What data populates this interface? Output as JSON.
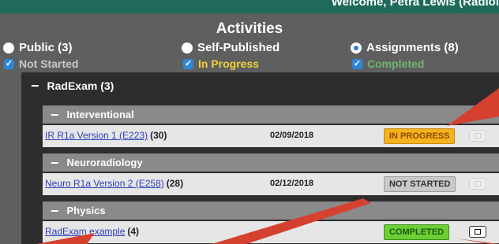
{
  "header": {
    "welcome_text": "Welcome, Petra Lewis (Radiol",
    "bar_color": "#1f6a5a"
  },
  "activities": {
    "title": "Activities",
    "filters": [
      {
        "label": "Public (3)",
        "checked": false
      },
      {
        "label": "Self-Published",
        "checked": false
      },
      {
        "label": "Assignments (8)",
        "checked": true
      }
    ],
    "status_filters": [
      {
        "label": "Not Started",
        "checked": true,
        "color": "#c9c9c9"
      },
      {
        "label": "In Progress",
        "checked": true,
        "color": "#f0d23a"
      },
      {
        "label": "Completed",
        "checked": true,
        "color": "#6bb56b"
      }
    ]
  },
  "radexam": {
    "group_label": "RadExam (3)",
    "sections": [
      {
        "title": "Interventional",
        "item": {
          "link": "IR R1a Version 1 (E223)",
          "count": "(30)",
          "date": "02/09/2018",
          "status": "IN PROGRESS",
          "status_key": "ip",
          "action_enabled": false
        }
      },
      {
        "title": "Neuroradiology",
        "item": {
          "link": "Neuro R1a Version 2 (E258)",
          "count": "(28)",
          "date": "02/12/2018",
          "status": "NOT STARTED",
          "status_key": "ns",
          "action_enabled": false
        }
      },
      {
        "title": "Physics",
        "item": {
          "link": "RadExam example",
          "count": "(4)",
          "date": "",
          "status": "COMPLETED",
          "status_key": "co",
          "action_enabled": true
        }
      }
    ]
  },
  "icons": {
    "collapse": "minus-icon",
    "radio": "radio-icon",
    "checkbox": "checkbox-checked-icon",
    "action": "square-icon"
  },
  "colors": {
    "panel_bg": "#5f5f5f",
    "callout_red": "#d6402f",
    "link": "#2b3fb8"
  }
}
